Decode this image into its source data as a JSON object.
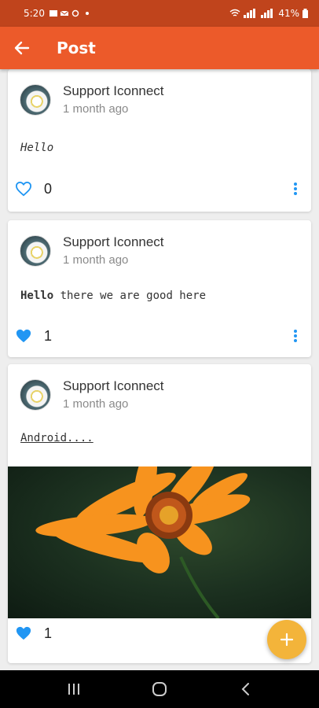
{
  "status_bar": {
    "time": "5:20",
    "battery": "41%"
  },
  "app_bar": {
    "title": "Post"
  },
  "posts": [
    {
      "author": "Support Iconnect",
      "time": "1 month ago",
      "text": "Hello",
      "likes": "0",
      "liked": false
    },
    {
      "author": "Support Iconnect",
      "time": "1 month ago",
      "text_bold": "Hello",
      "text_rest": " there we are good here",
      "likes": "1",
      "liked": true
    },
    {
      "author": "Support Iconnect",
      "time": "1 month ago",
      "text": "Android....",
      "likes": "1",
      "liked": true
    }
  ],
  "colors": {
    "status_bar": "#c0441c",
    "app_bar": "#ec5a2a",
    "like": "#2196f3",
    "fab": "#f3b43a"
  },
  "icons": {
    "back": "arrow-left-icon",
    "like_empty": "heart-outline-icon",
    "like_filled": "heart-filled-icon",
    "more": "more-vertical-icon",
    "fab": "plus-icon"
  }
}
